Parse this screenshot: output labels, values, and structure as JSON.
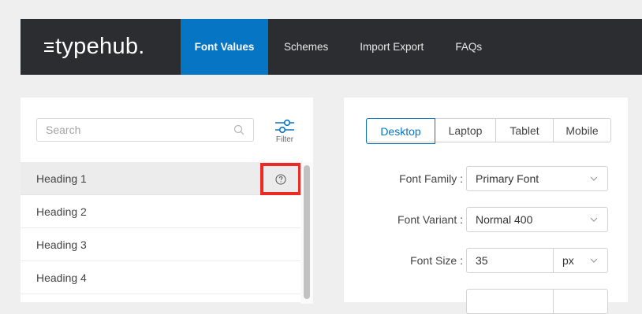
{
  "brand": {
    "name": "typehub."
  },
  "nav": {
    "items": [
      {
        "label": "Font Values",
        "active": true
      },
      {
        "label": "Schemes"
      },
      {
        "label": "Import Export"
      },
      {
        "label": "FAQs"
      }
    ]
  },
  "left_panel": {
    "search": {
      "placeholder": "Search",
      "icon": "search-icon"
    },
    "filter": {
      "label": "Filter",
      "icon": "sliders-icon"
    },
    "items": [
      {
        "label": "Heading 1",
        "selected": true,
        "help_icon": "question-circle-icon"
      },
      {
        "label": "Heading 2"
      },
      {
        "label": "Heading 3"
      },
      {
        "label": "Heading 4"
      }
    ]
  },
  "right_panel": {
    "device_tabs": [
      {
        "label": "Desktop",
        "active": true
      },
      {
        "label": "Laptop"
      },
      {
        "label": "Tablet"
      },
      {
        "label": "Mobile"
      }
    ],
    "fields": {
      "font_family": {
        "label": "Font Family :",
        "value": "Primary Font"
      },
      "font_variant": {
        "label": "Font Variant :",
        "value": "Normal 400"
      },
      "font_size": {
        "label": "Font Size :",
        "value": "35",
        "unit": "px"
      }
    }
  },
  "colors": {
    "topbar": "#2c2d30",
    "accent": "#0675c4",
    "highlight": "#ee2a24"
  }
}
